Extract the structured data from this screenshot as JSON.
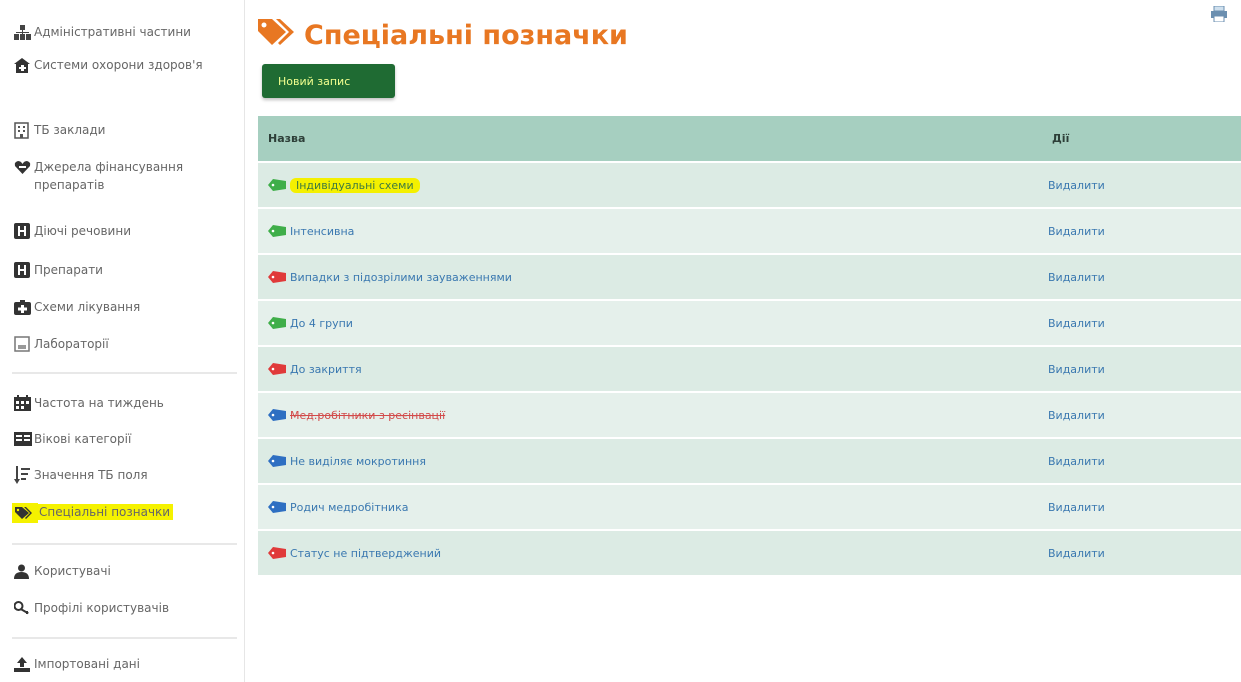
{
  "sidebar": {
    "items": [
      {
        "label": "Адміністративні частини",
        "icon": "org-chart-icon"
      },
      {
        "label": "Системи охорони здоров'я",
        "icon": "health-system-icon"
      },
      {
        "label": "ТБ заклади",
        "icon": "building-icon"
      },
      {
        "label": "Джерела фінансування препаратів",
        "icon": "funding-icon"
      },
      {
        "label": "Діючі речовини",
        "icon": "substance-icon"
      },
      {
        "label": "Препарати",
        "icon": "drug-icon"
      },
      {
        "label": "Схеми лікування",
        "icon": "treatment-scheme-icon"
      },
      {
        "label": "Лабораторії",
        "icon": "laboratory-icon"
      },
      {
        "label": "Частота на тиждень",
        "icon": "calendar-icon"
      },
      {
        "label": "Вікові категорії",
        "icon": "age-category-icon"
      },
      {
        "label": "Значення ТБ поля",
        "icon": "sort-fields-icon"
      },
      {
        "label": "Спеціальні позначки",
        "icon": "tags-icon"
      },
      {
        "label": "Користувачі",
        "icon": "user-icon"
      },
      {
        "label": "Профілі користувачів",
        "icon": "key-icon"
      },
      {
        "label": "Імпортовані дані",
        "icon": "import-icon"
      }
    ]
  },
  "header": {
    "title": "Спеціальні позначки",
    "new_button": "Новий запис"
  },
  "table": {
    "col_name": "Назва",
    "col_actions": "Дії",
    "rows": [
      {
        "name": "Індивідуальні схеми",
        "color": "#3fae49",
        "action": "Видалити",
        "highlight": true
      },
      {
        "name": "Інтенсивна",
        "color": "#3fae49",
        "action": "Видалити"
      },
      {
        "name": "Випадки з підозрілими зауваженнями",
        "color": "#e03a3a",
        "action": "Видалити"
      },
      {
        "name": "До 4 групи",
        "color": "#3fae49",
        "action": "Видалити"
      },
      {
        "name": "До закриття",
        "color": "#e03a3a",
        "action": "Видалити"
      },
      {
        "name": "Мед.робітники з реєінвації",
        "color": "#2e6fc2",
        "action": "Видалити",
        "strike": true
      },
      {
        "name": "Не виділяє мокротиння",
        "color": "#2e6fc2",
        "action": "Видалити"
      },
      {
        "name": "Родич медробітника",
        "color": "#2e6fc2",
        "action": "Видалити"
      },
      {
        "name": "Статус не підтверджений",
        "color": "#e03a3a",
        "action": "Видалити"
      }
    ]
  }
}
